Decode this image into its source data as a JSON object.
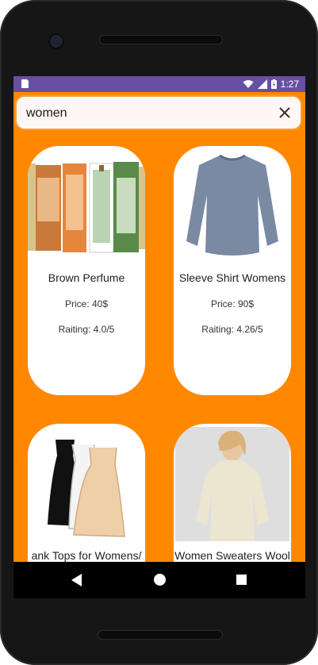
{
  "status": {
    "time": "1:27"
  },
  "search": {
    "query": "women"
  },
  "products": [
    {
      "title": "Brown Perfume",
      "price": "Price: 40$",
      "rating": "Raiting: 4.0/5"
    },
    {
      "title": "Sleeve Shirt Womens",
      "price": "Price: 90$",
      "rating": "Raiting: 4.26/5"
    },
    {
      "title": "ank Tops for Womens/",
      "price": "",
      "rating": ""
    },
    {
      "title": "Women Sweaters Wool",
      "price": "",
      "rating": ""
    }
  ],
  "colors": {
    "accent": "#ff8800",
    "status_bar": "#6750a4"
  },
  "icons": {
    "clear": "close-icon",
    "back": "back-icon",
    "home": "home-icon",
    "recent": "recent-apps-icon"
  }
}
